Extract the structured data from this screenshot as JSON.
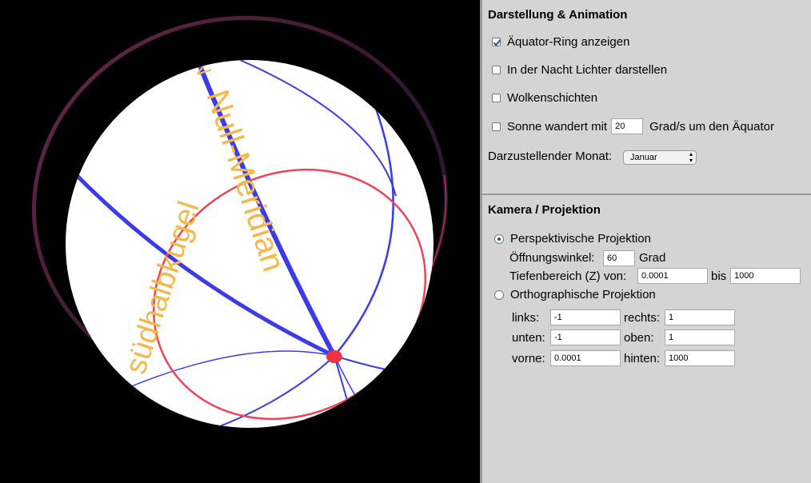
{
  "viewport": {
    "labels": {
      "meridian": "Null-Meridian",
      "southern": "südhalbkugel",
      "top_fragment": "N"
    },
    "colors": {
      "sphere": "#ffffff",
      "meridian_lines": "#3c3ce6",
      "equator_ring": "#ee4455",
      "outer_ring": "#5a2040",
      "label_text": "#f5b84a",
      "pole_dot": "#ee3344"
    }
  },
  "display": {
    "title": "Darstellung & Animation",
    "equator_ring": {
      "label": "Äquator-Ring anzeigen",
      "checked": true
    },
    "night_lights": {
      "label": "In der Nacht Lichter darstellen",
      "checked": false
    },
    "cloud_layers": {
      "label": "Wolkenschichten",
      "checked": false
    },
    "sun": {
      "label_before": "Sonne wandert mit",
      "value": "20",
      "label_after": "Grad/s um den Äquator",
      "checked": false
    },
    "month": {
      "label": "Darzustellender Monat:",
      "value": "Januar"
    }
  },
  "camera": {
    "title": "Kamera / Projektion",
    "perspective": {
      "label": "Perspektivische Projektion",
      "selected": true,
      "fov_label": "Öffnungswinkel:",
      "fov_value": "60",
      "fov_unit": "Grad",
      "depth_label": "Tiefenbereich (Z) von:",
      "depth_from": "0.0001",
      "depth_to_label": "bis",
      "depth_to": "1000"
    },
    "orthographic": {
      "label": "Orthographische Projektion",
      "selected": false,
      "left_label": "links:",
      "left_value": "-1",
      "right_label": "rechts:",
      "right_value": "1",
      "bottom_label": "unten:",
      "bottom_value": "-1",
      "top_label": "oben:",
      "top_value": "1",
      "near_label": "vorne:",
      "near_value": "0.0001",
      "far_label": "hinten:",
      "far_value": "1000"
    }
  }
}
